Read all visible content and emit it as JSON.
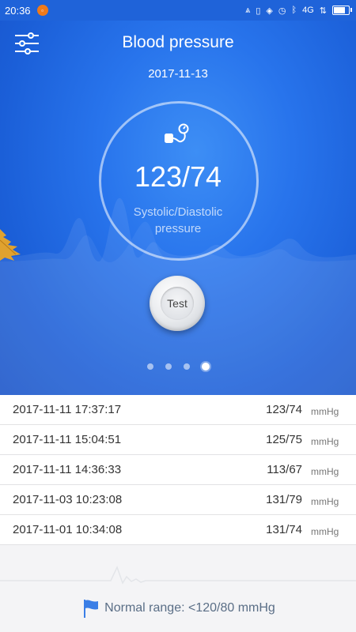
{
  "status": {
    "time": "20:36",
    "network": "4G"
  },
  "header": {
    "title": "Blood pressure",
    "date": "2017-11-13"
  },
  "reading": {
    "value": "123/74",
    "label_line1": "Systolic/Diastolic",
    "label_line2": "pressure"
  },
  "test_button": {
    "label": "Test"
  },
  "pager": {
    "count": 4,
    "active_index": 3
  },
  "records": [
    {
      "datetime": "2017-11-11 17:37:17",
      "value": "123/74",
      "unit": "mmHg"
    },
    {
      "datetime": "2017-11-11 15:04:51",
      "value": "125/75",
      "unit": "mmHg"
    },
    {
      "datetime": "2017-11-11 14:36:33",
      "value": "113/67",
      "unit": "mmHg"
    },
    {
      "datetime": "2017-11-03 10:23:08",
      "value": "131/79",
      "unit": "mmHg"
    },
    {
      "datetime": "2017-11-01 10:34:08",
      "value": "131/74",
      "unit": "mmHg"
    }
  ],
  "footer": {
    "text": "Normal range: <120/80 mmHg"
  },
  "colors": {
    "hero": "#2874ec",
    "accent": "#3a7ee6",
    "footer_text": "#5a6e86"
  }
}
